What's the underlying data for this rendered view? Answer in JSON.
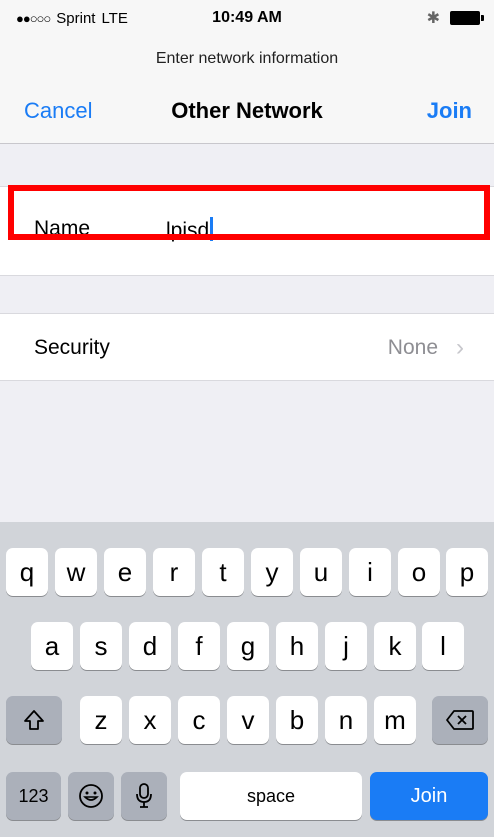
{
  "status_bar": {
    "signal": "●●○○○",
    "carrier": "Sprint",
    "network": "LTE",
    "time": "10:49 AM",
    "bluetooth_icon": "bluetooth-icon",
    "battery_icon": "battery-icon"
  },
  "nav": {
    "prompt": "Enter network information",
    "cancel_label": "Cancel",
    "title": "Other Network",
    "join_label": "Join"
  },
  "form": {
    "name_label": "Name",
    "name_value": "lpisd",
    "security_label": "Security",
    "security_value": "None",
    "chevron": "›"
  },
  "keyboard": {
    "row1": [
      "q",
      "w",
      "e",
      "r",
      "t",
      "y",
      "u",
      "i",
      "o",
      "p"
    ],
    "row2": [
      "a",
      "s",
      "d",
      "f",
      "g",
      "h",
      "j",
      "k",
      "l"
    ],
    "row3": [
      "z",
      "x",
      "c",
      "v",
      "b",
      "n",
      "m"
    ],
    "shift_icon": "shift-icon",
    "delete_icon": "delete-icon",
    "numbers_label": "123",
    "emoji_icon": "emoji-icon",
    "mic_icon": "microphone-icon",
    "space_label": "space",
    "join_label": "Join"
  },
  "colors": {
    "accent": "#1a7cf5",
    "highlight": "#ff0000",
    "background": "#efeff4"
  }
}
